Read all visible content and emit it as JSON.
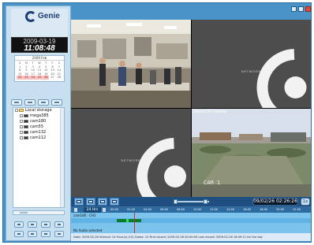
{
  "brand": {
    "name": "Genie"
  },
  "clock": {
    "date": "2009-03-19",
    "time": "11:08:48"
  },
  "calendar": {
    "month_label": "2009 Feb",
    "weekdays": [
      "S",
      "M",
      "T",
      "W",
      "T",
      "F",
      "S"
    ],
    "days": [
      "1",
      "2",
      "3",
      "4",
      "5",
      "6",
      "7",
      "8",
      "9",
      "10",
      "11",
      "12",
      "13",
      "14",
      "15",
      "16",
      "17",
      "18",
      "19",
      "20",
      "21",
      "22",
      "23",
      "24",
      "25",
      "26",
      "27",
      "28"
    ],
    "recorded_days": [
      "22",
      "23",
      "24",
      "25",
      "26"
    ]
  },
  "tree": {
    "root": "Local storage",
    "items": [
      "mega385",
      "cam180",
      "cam55",
      "cam132",
      "cam112"
    ]
  },
  "videos": {
    "watermark": "NETWORK",
    "cam4_label": "CAM 1",
    "cam4_date": "Internal IP Camera"
  },
  "controls": {
    "datetime": "09/02/26 02:26:26",
    "scale": "1x"
  },
  "timeline": {
    "mode": "24 Hrs",
    "hours": [
      "00:00",
      "02:00",
      "04:00",
      "06:00",
      "08:00",
      "10:00",
      "12:00",
      "14:00",
      "16:00",
      "18:00",
      "20:00",
      "22:00"
    ],
    "channel_label": "cam180 : CH1",
    "no_audio": "No Audio selected",
    "footer": "Date: 2009-02-26   Interval: 24 Hour(s) (10)   Gama: 12     First record: 2009-02-26 00:00:00          Last record: 2009-02-26 16:09:11 for the day"
  }
}
